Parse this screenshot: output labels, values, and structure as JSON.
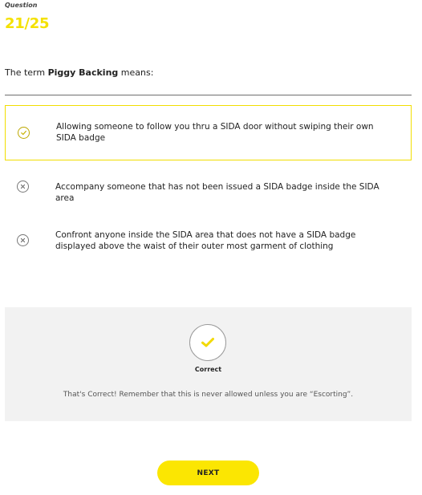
{
  "header": {
    "question_label": "Question",
    "counter": "21/25"
  },
  "prompt": {
    "prefix": "The term ",
    "term": "Piggy Backing",
    "suffix": " means:"
  },
  "options": [
    {
      "text": "Allowing someone to follow you thru a SIDA door without swiping their own SIDA badge",
      "state": "selected-correct",
      "icon": "check-circle-icon"
    },
    {
      "text": "Accompany someone that has not been issued a SIDA badge inside the SIDA area",
      "state": "incorrect",
      "icon": "x-circle-icon"
    },
    {
      "text": "Confront anyone inside the SIDA area that does not have a SIDA badge displayed above the waist of their outer most garment of clothing",
      "state": "incorrect",
      "icon": "x-circle-icon"
    }
  ],
  "feedback": {
    "icon": "checkmark-icon",
    "title": "Correct",
    "message": "That's Correct! Remember that this is never allowed unless you are “Escorting”."
  },
  "next_button": {
    "label": "NEXT"
  },
  "colors": {
    "accent": "#fbe602",
    "counter": "#f4e100",
    "selected_border": "#f2de00",
    "feedback_bg": "#f2f2f2"
  }
}
